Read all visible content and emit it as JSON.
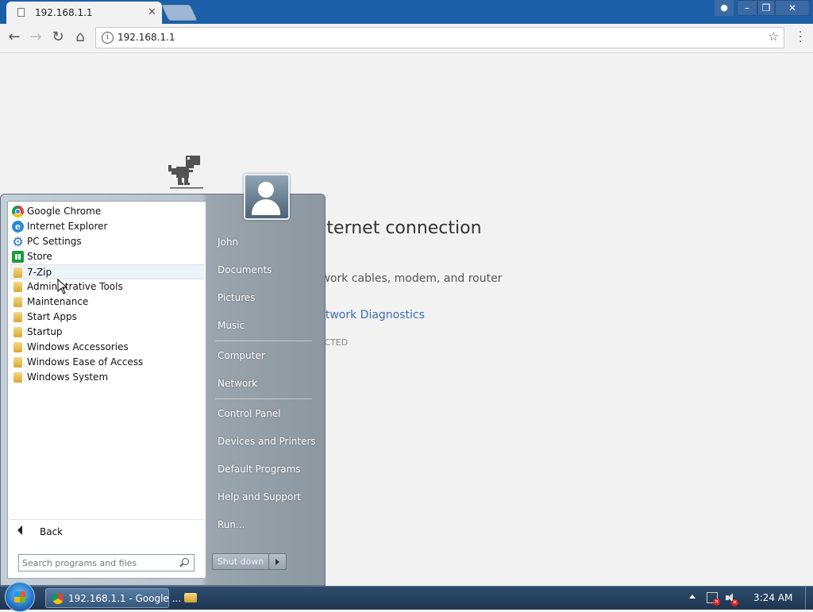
{
  "browser": {
    "tab_title": "192.168.1.1",
    "url": "192.168.1.1",
    "profile_icon": "person-icon"
  },
  "error_page": {
    "title": "There is no Internet connection",
    "hint": "Try checking the network cables, modem, and router",
    "link": "Running Windows Network Diagnostics",
    "code": "ERR_INTERNET_DISCONNECTED"
  },
  "start_menu": {
    "programs": [
      {
        "label": "Google Chrome",
        "icon": "chrome-icon"
      },
      {
        "label": "Internet Explorer",
        "icon": "ie-icon"
      },
      {
        "label": "PC Settings",
        "icon": "gear-icon"
      },
      {
        "label": "Store",
        "icon": "store-icon"
      },
      {
        "label": "7-Zip",
        "icon": "folder-icon"
      },
      {
        "label": "Administrative Tools",
        "icon": "folder-icon"
      },
      {
        "label": "Maintenance",
        "icon": "folder-icon"
      },
      {
        "label": "Start Apps",
        "icon": "folder-icon"
      },
      {
        "label": "Startup",
        "icon": "folder-icon"
      },
      {
        "label": "Windows Accessories",
        "icon": "folder-icon"
      },
      {
        "label": "Windows Ease of Access",
        "icon": "folder-icon"
      },
      {
        "label": "Windows System",
        "icon": "folder-icon"
      }
    ],
    "back_label": "Back",
    "search_placeholder": "Search programs and files",
    "right_pane": {
      "user": "John",
      "documents": "Documents",
      "pictures": "Pictures",
      "music": "Music",
      "computer": "Computer",
      "network": "Network",
      "control_panel": "Control Panel",
      "devices": "Devices and Printers",
      "default_programs": "Default Programs",
      "help": "Help and Support",
      "run": "Run..."
    },
    "shutdown_label": "Shut down"
  },
  "taskbar": {
    "chrome_button_label": "192.168.1.1 - Google ...",
    "clock": "3:24 AM"
  }
}
